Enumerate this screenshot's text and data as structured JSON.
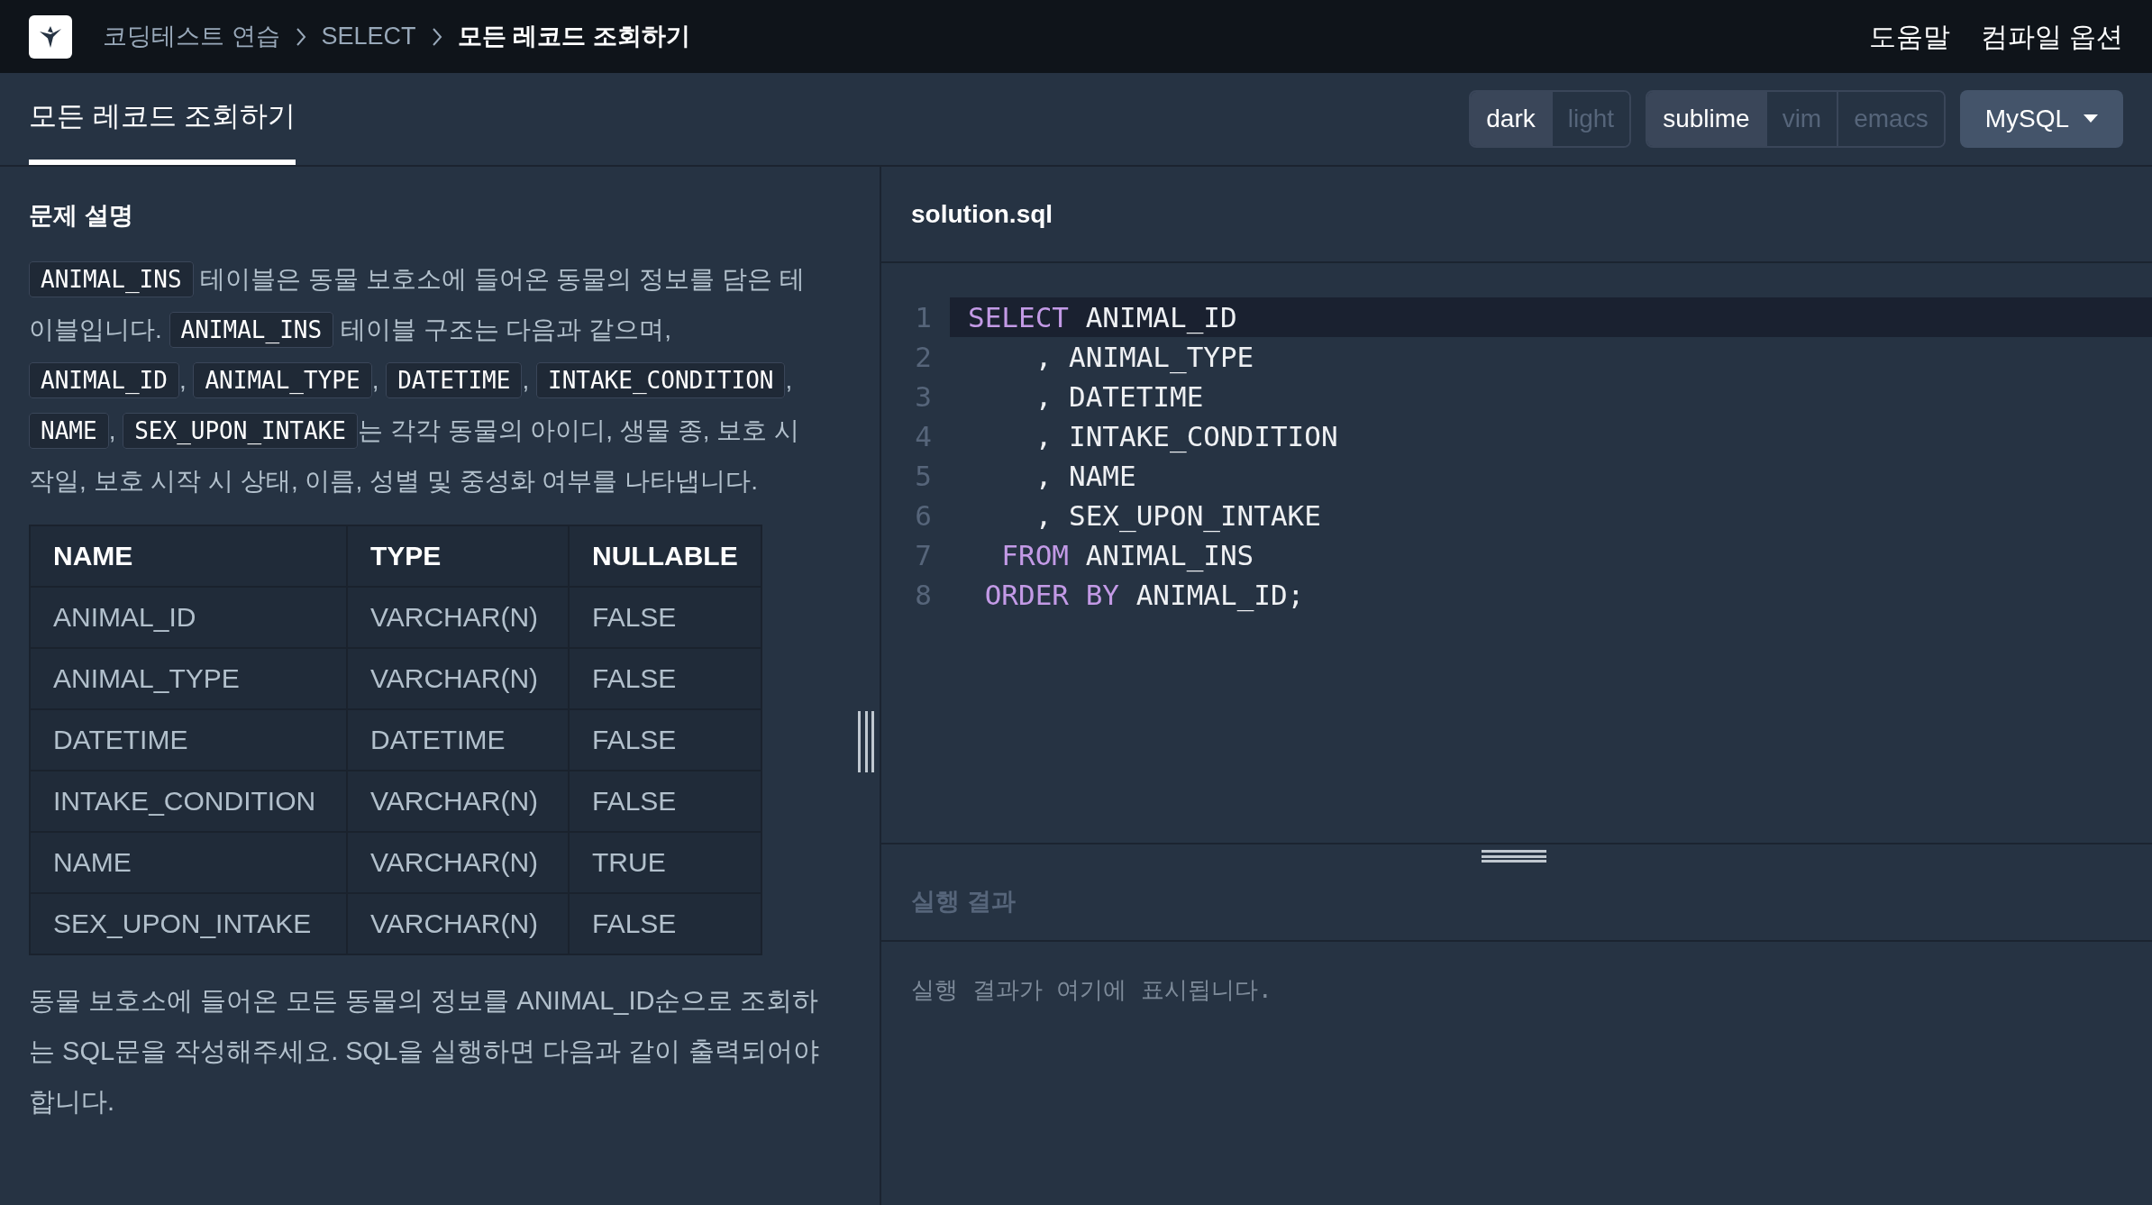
{
  "breadcrumb": [
    {
      "label": "코딩테스트 연습",
      "current": false
    },
    {
      "label": "SELECT",
      "current": false
    },
    {
      "label": "모든 레코드 조회하기",
      "current": true
    }
  ],
  "header_links": [
    "도움말",
    "컴파일 옵션"
  ],
  "tabs": [
    {
      "label": "모든 레코드 조회하기",
      "selected": true
    }
  ],
  "theme_toggle": [
    {
      "label": "dark",
      "selected": true
    },
    {
      "label": "light",
      "selected": false
    }
  ],
  "keymap_toggle": [
    {
      "label": "sublime",
      "selected": true
    },
    {
      "label": "vim",
      "selected": false
    },
    {
      "label": "emacs",
      "selected": false
    }
  ],
  "language_dropdown": {
    "label": "MySQL"
  },
  "description": {
    "heading": "문제 설명",
    "intro": [
      {
        "kind": "code",
        "text": "ANIMAL_INS"
      },
      {
        "kind": "text",
        "text": " 테이블은 동물 보호소에 들어온 동물의 정보를 담은 테이블입니다. "
      },
      {
        "kind": "code",
        "text": "ANIMAL_INS"
      },
      {
        "kind": "text",
        "text": " 테이블 구조는 다음과 같으며, "
      },
      {
        "kind": "code",
        "text": "ANIMAL_ID"
      },
      {
        "kind": "text",
        "text": ", "
      },
      {
        "kind": "code",
        "text": "ANIMAL_TYPE"
      },
      {
        "kind": "text",
        "text": ", "
      },
      {
        "kind": "code",
        "text": "DATETIME"
      },
      {
        "kind": "text",
        "text": ", "
      },
      {
        "kind": "code",
        "text": "INTAKE_CONDITION"
      },
      {
        "kind": "text",
        "text": ", "
      },
      {
        "kind": "code",
        "text": "NAME"
      },
      {
        "kind": "text",
        "text": ", "
      },
      {
        "kind": "code",
        "text": "SEX_UPON_INTAKE"
      },
      {
        "kind": "text",
        "text": "는 각각 동물의 아이디, 생물 종, 보호 시작일, 보호 시작 시 상태, 이름, 성별 및 중성화 여부를 나타냅니다."
      }
    ],
    "table": {
      "columns": [
        "NAME",
        "TYPE",
        "NULLABLE"
      ],
      "rows": [
        [
          "ANIMAL_ID",
          "VARCHAR(N)",
          "FALSE"
        ],
        [
          "ANIMAL_TYPE",
          "VARCHAR(N)",
          "FALSE"
        ],
        [
          "DATETIME",
          "DATETIME",
          "FALSE"
        ],
        [
          "INTAKE_CONDITION",
          "VARCHAR(N)",
          "FALSE"
        ],
        [
          "NAME",
          "VARCHAR(N)",
          "TRUE"
        ],
        [
          "SEX_UPON_INTAKE",
          "VARCHAR(N)",
          "FALSE"
        ]
      ]
    },
    "task": "동물 보호소에 들어온 모든 동물의 정보를 ANIMAL_ID순으로 조회하는 SQL문을 작성해주세요. SQL을 실행하면 다음과 같이 출력되어야 합니다."
  },
  "editor": {
    "filename": "solution.sql",
    "lines": [
      {
        "number": "1",
        "active": true,
        "tokens": [
          {
            "kind": "keyword",
            "text": "SELECT"
          },
          {
            "kind": "plain",
            "text": " ANIMAL_ID"
          }
        ]
      },
      {
        "number": "2",
        "active": false,
        "tokens": [
          {
            "kind": "plain",
            "text": "    , ANIMAL_TYPE"
          }
        ]
      },
      {
        "number": "3",
        "active": false,
        "tokens": [
          {
            "kind": "plain",
            "text": "    , DATETIME"
          }
        ]
      },
      {
        "number": "4",
        "active": false,
        "tokens": [
          {
            "kind": "plain",
            "text": "    , INTAKE_CONDITION"
          }
        ]
      },
      {
        "number": "5",
        "active": false,
        "tokens": [
          {
            "kind": "plain",
            "text": "    , NAME"
          }
        ]
      },
      {
        "number": "6",
        "active": false,
        "tokens": [
          {
            "kind": "plain",
            "text": "    , SEX_UPON_INTAKE"
          }
        ]
      },
      {
        "number": "7",
        "active": false,
        "tokens": [
          {
            "kind": "keyword",
            "text": "  FROM"
          },
          {
            "kind": "plain",
            "text": " ANIMAL_INS"
          }
        ]
      },
      {
        "number": "8",
        "active": false,
        "tokens": [
          {
            "kind": "keyword",
            "text": " ORDER BY"
          },
          {
            "kind": "plain",
            "text": " ANIMAL_ID;"
          }
        ]
      }
    ]
  },
  "result": {
    "heading": "실행 결과",
    "empty_message": "실행 결과가 여기에 표시됩니다."
  }
}
